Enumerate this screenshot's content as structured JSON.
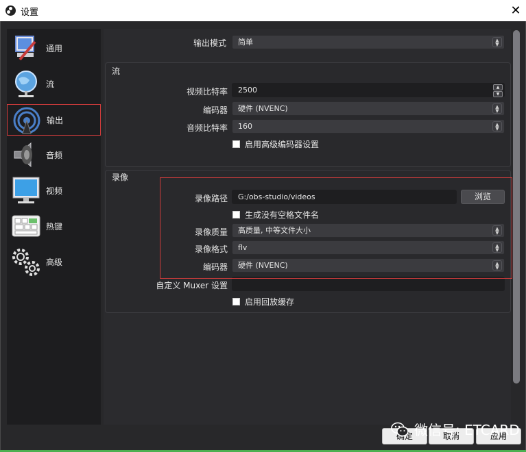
{
  "window": {
    "title": "设置"
  },
  "sidebar": {
    "items": [
      {
        "label": "通用",
        "icon": "general-icon"
      },
      {
        "label": "流",
        "icon": "stream-globe-icon"
      },
      {
        "label": "输出",
        "icon": "output-broadcast-icon",
        "active": true
      },
      {
        "label": "音频",
        "icon": "audio-speaker-icon"
      },
      {
        "label": "视频",
        "icon": "video-monitor-icon"
      },
      {
        "label": "热键",
        "icon": "hotkeys-keyboard-icon"
      },
      {
        "label": "高级",
        "icon": "advanced-gears-icon"
      }
    ]
  },
  "output_mode": {
    "label": "输出模式",
    "value": "简单"
  },
  "stream_section": {
    "title": "流",
    "video_bitrate": {
      "label": "视频比特率",
      "value": "2500"
    },
    "encoder": {
      "label": "编码器",
      "value": "硬件 (NVENC)"
    },
    "audio_bitrate": {
      "label": "音频比特率",
      "value": "160"
    },
    "advanced_encoder_checkbox": "启用高级编码器设置"
  },
  "recording_section": {
    "title": "录像",
    "path": {
      "label": "录像路径",
      "value": "G:/obs-studio/videos",
      "browse_label": "浏览"
    },
    "no_space_filename_checkbox": "生成没有空格文件名",
    "quality": {
      "label": "录像质量",
      "value": "高质量, 中等文件大小"
    },
    "format": {
      "label": "录像格式",
      "value": "flv"
    },
    "encoder": {
      "label": "编码器",
      "value": "硬件 (NVENC)"
    },
    "custom_muxer": {
      "label": "自定义 Muxer 设置",
      "value": ""
    },
    "replay_buffer_checkbox": "启用回放缓存"
  },
  "footer": {
    "ok_label": "确定",
    "cancel_label": "取消",
    "apply_label": "应用"
  },
  "watermark": {
    "text": "微信号: ETCARD"
  },
  "colors": {
    "highlight": "#d23c3c",
    "panel_bg": "#2b2b2e",
    "sidebar_bg": "#1d1d1f"
  }
}
